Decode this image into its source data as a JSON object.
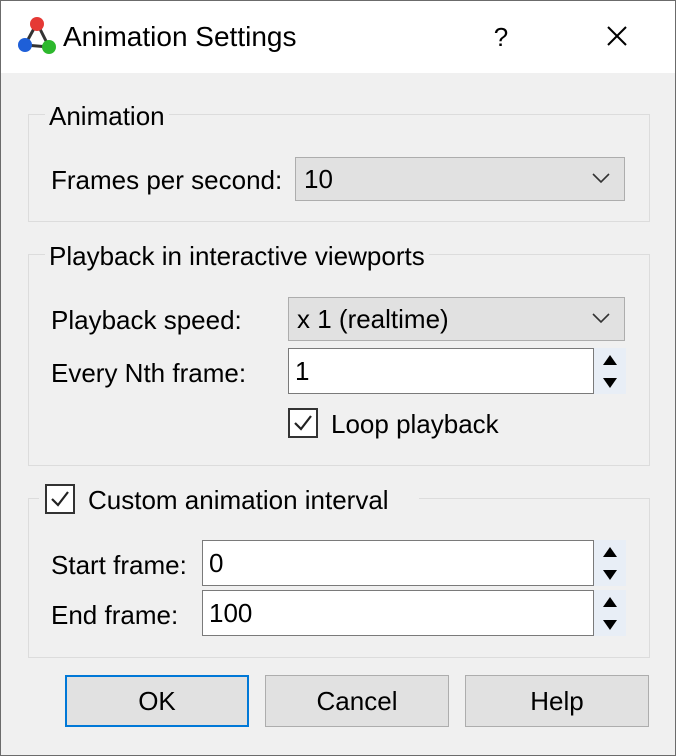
{
  "window": {
    "title": "Animation Settings",
    "help_glyph": "?",
    "icons": {
      "app": "molecule-app-icon",
      "close": "close-icon"
    }
  },
  "animation_group": {
    "title": "Animation",
    "fps_label": "Frames per second:",
    "fps_value": "10"
  },
  "playback_group": {
    "title": "Playback in interactive viewports",
    "speed_label": "Playback speed:",
    "speed_value": "x 1 (realtime)",
    "nth_label": "Every Nth frame:",
    "nth_value": "1",
    "loop_label": "Loop playback",
    "loop_checked": true
  },
  "interval_group": {
    "title": "Custom animation interval",
    "checked": true,
    "start_label": "Start frame:",
    "start_value": "0",
    "end_label": "End frame:",
    "end_value": "100"
  },
  "buttons": {
    "ok": "OK",
    "cancel": "Cancel",
    "help": "Help"
  },
  "colors": {
    "accent": "#0078d7",
    "dialog_bg": "#f0f0f0",
    "spin_bg": "#e8eef6"
  }
}
